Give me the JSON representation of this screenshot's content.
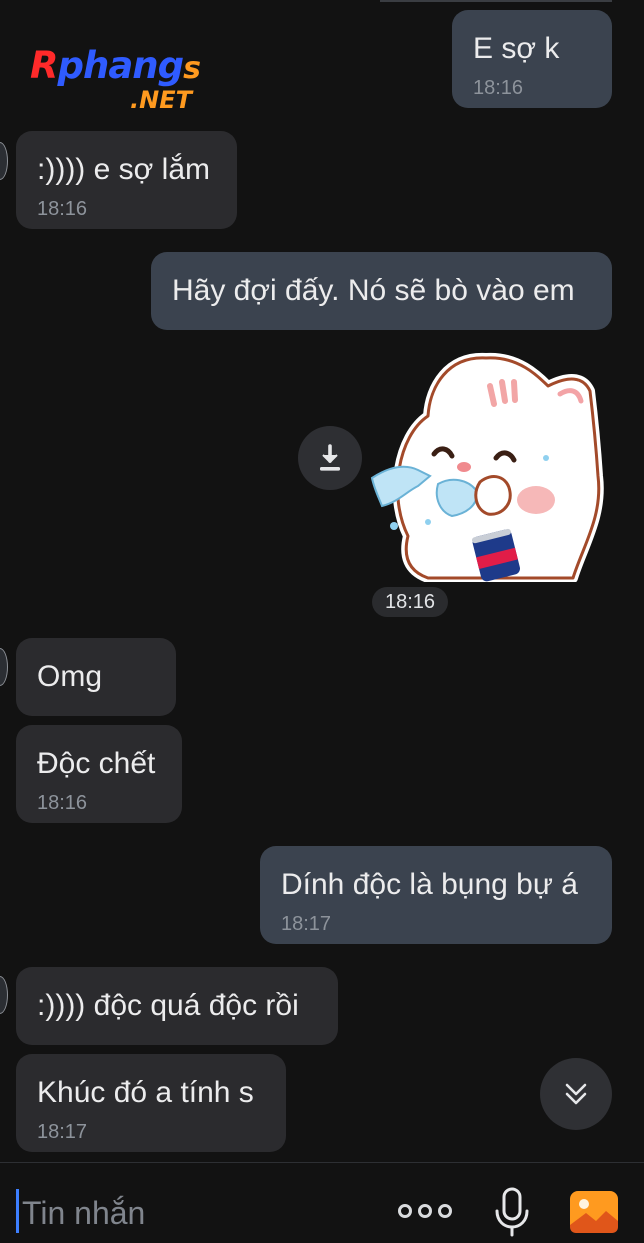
{
  "watermark": {
    "brand": "Rphangs",
    "domain": ".NET"
  },
  "messages": [
    {
      "dir": "out",
      "text": "E sợ k",
      "time": "18:16"
    },
    {
      "dir": "in",
      "text": ":)))) e sợ lắm",
      "time": "18:16"
    },
    {
      "dir": "out",
      "text": "Hãy đợi đấy. Nó sẽ bò vào em"
    },
    {
      "dir": "out",
      "type": "sticker",
      "sticker": "crying-cat-drinking-sticker",
      "time": "18:16"
    },
    {
      "dir": "in",
      "text": "Omg"
    },
    {
      "dir": "in",
      "text": "Độc chết",
      "time": "18:16"
    },
    {
      "dir": "out",
      "text": "Dính độc là bụng bự á",
      "time": "18:17"
    },
    {
      "dir": "in",
      "text": ":)))) độc quá độc rồi"
    },
    {
      "dir": "in",
      "text": "Khúc đó a tính s",
      "time": "18:17"
    }
  ],
  "icons": {
    "download": "download-icon",
    "scroll_down": "double-chevron-down-icon",
    "more": "more-options-icon",
    "mic": "microphone-icon",
    "image": "image-icon"
  },
  "composer": {
    "placeholder": "Tin nhắn"
  },
  "colors": {
    "background": "#121212",
    "incoming_bubble": "#2b2b2e",
    "outgoing_bubble": "#3b434f",
    "cursor": "#3d7fff",
    "image_icon": "#ff9a1f"
  }
}
